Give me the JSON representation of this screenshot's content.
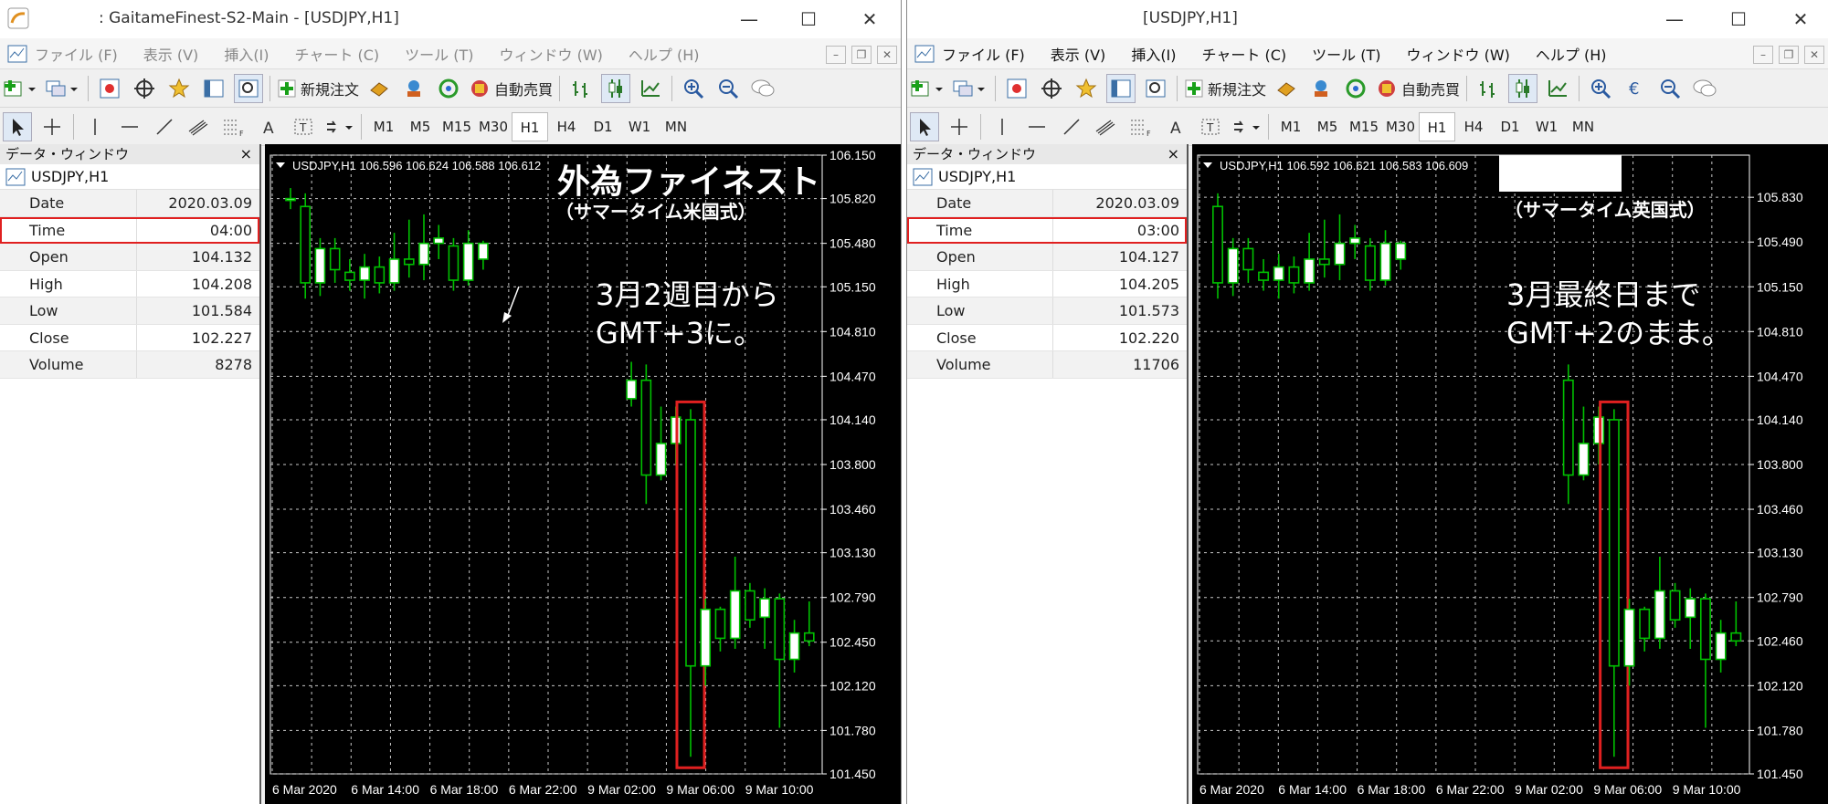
{
  "windows": [
    {
      "id": "A",
      "title": ": GaitameFinest-S2-Main - [USDJPY,H1]",
      "menu": [
        "ファイル (F)",
        "表示 (V)",
        "挿入(I)",
        "チャート (C)",
        "ツール (T)",
        "ウィンドウ (W)",
        "ヘルプ (H)"
      ],
      "toolbar": {
        "new_order": "新規注文",
        "auto_trade": "自動売買"
      },
      "timeframes": [
        "M1",
        "M5",
        "M15",
        "M30",
        "H1",
        "H4",
        "D1",
        "W1",
        "MN"
      ],
      "active_tf": "H1",
      "data_window": {
        "title": "データ・ウィンドウ",
        "symbol": "USDJPY,H1",
        "rows": [
          {
            "k": "Date",
            "v": "2020.03.09"
          },
          {
            "k": "Time",
            "v": "04:00"
          },
          {
            "k": "Open",
            "v": "104.132"
          },
          {
            "k": "High",
            "v": "104.208"
          },
          {
            "k": "Low",
            "v": "101.584"
          },
          {
            "k": "Close",
            "v": "102.227"
          },
          {
            "k": "Volume",
            "v": "8278"
          }
        ]
      },
      "chart_header": "USDJPY,H1  106.596 106.624 106.588 106.612",
      "annotations": {
        "heading": "外為ファイネスト",
        "subheading": "（サマータイム米国式）",
        "note1": "3月2週目から",
        "note2": "GMT+3に。"
      }
    },
    {
      "id": "B",
      "title": "[USDJPY,H1]",
      "menu": [
        "ファイル (F)",
        "表示 (V)",
        "挿入(I)",
        "チャート (C)",
        "ツール (T)",
        "ウィンドウ (W)",
        "ヘルプ (H)"
      ],
      "toolbar": {
        "new_order": "新規注文",
        "auto_trade": "自動売買"
      },
      "timeframes": [
        "M1",
        "M5",
        "M15",
        "M30",
        "H1",
        "H4",
        "D1",
        "W1",
        "MN"
      ],
      "active_tf": "H1",
      "data_window": {
        "title": "データ・ウィンドウ",
        "symbol": "USDJPY,H1",
        "rows": [
          {
            "k": "Date",
            "v": "2020.03.09"
          },
          {
            "k": "Time",
            "v": "03:00"
          },
          {
            "k": "Open",
            "v": "104.127"
          },
          {
            "k": "High",
            "v": "104.205"
          },
          {
            "k": "Low",
            "v": "101.573"
          },
          {
            "k": "Close",
            "v": "102.220"
          },
          {
            "k": "Volume",
            "v": "11706"
          }
        ]
      },
      "chart_header": "USDJPY,H1  106.592 106.621 106.583 106.609",
      "annotations": {
        "heading": "",
        "subheading": "（サマータイム英国式）",
        "note1": "3月最終日まで",
        "note2": "GMT+2のまま。"
      }
    }
  ],
  "chart_data": [
    {
      "type": "candlestick",
      "title": "USDJPY,H1",
      "yticks": [
        106.15,
        105.82,
        105.48,
        105.15,
        104.81,
        104.47,
        104.14,
        103.8,
        103.46,
        103.13,
        102.79,
        102.45,
        102.12,
        101.78,
        101.45
      ],
      "ylim": [
        101.45,
        106.15
      ],
      "xticks": [
        "6 Mar 2020",
        "6 Mar 14:00",
        "6 Mar 18:00",
        "6 Mar 22:00",
        "9 Mar 02:00",
        "9 Mar 06:00",
        "9 Mar 10:00"
      ],
      "grid": true,
      "candles": [
        {
          "o": 105.82,
          "c": 105.82,
          "h": 105.9,
          "l": 105.74
        },
        {
          "o": 105.76,
          "c": 105.18,
          "h": 105.86,
          "l": 105.06
        },
        {
          "o": 105.18,
          "c": 105.44,
          "h": 105.52,
          "l": 105.08
        },
        {
          "o": 105.44,
          "c": 105.28,
          "h": 105.52,
          "l": 105.18
        },
        {
          "o": 105.26,
          "c": 105.2,
          "h": 105.36,
          "l": 105.12
        },
        {
          "o": 105.2,
          "c": 105.3,
          "h": 105.4,
          "l": 105.06
        },
        {
          "o": 105.3,
          "c": 105.18,
          "h": 105.38,
          "l": 105.1
        },
        {
          "o": 105.18,
          "c": 105.36,
          "h": 105.56,
          "l": 105.12
        },
        {
          "o": 105.36,
          "c": 105.32,
          "h": 105.66,
          "l": 105.22
        },
        {
          "o": 105.32,
          "c": 105.48,
          "h": 105.7,
          "l": 105.2
        },
        {
          "o": 105.48,
          "c": 105.52,
          "h": 105.62,
          "l": 105.36
        },
        {
          "o": 105.46,
          "c": 105.2,
          "h": 105.52,
          "l": 105.12
        },
        {
          "o": 105.2,
          "c": 105.48,
          "h": 105.58,
          "l": 105.16
        },
        {
          "o": 105.36,
          "c": 105.48,
          "h": 105.5,
          "l": 105.28
        },
        {
          "gap": true
        },
        {
          "gap": true
        },
        {
          "gap": true
        },
        {
          "gap": true
        },
        {
          "gap": true
        },
        {
          "gap": true
        },
        {
          "gap": true
        },
        {
          "gap": true
        },
        {
          "gap": true
        },
        {
          "o": 104.3,
          "c": 104.44,
          "h": 104.58,
          "l": 104.24
        },
        {
          "o": 104.44,
          "c": 103.72,
          "h": 104.56,
          "l": 103.5
        },
        {
          "o": 103.72,
          "c": 103.96,
          "h": 104.24,
          "l": 103.68
        },
        {
          "o": 103.96,
          "c": 104.16,
          "h": 104.24,
          "l": 103.8
        },
        {
          "o": 104.14,
          "c": 102.27,
          "h": 104.22,
          "l": 101.58
        },
        {
          "o": 102.27,
          "c": 102.7,
          "h": 102.78,
          "l": 102.12
        },
        {
          "o": 102.7,
          "c": 102.48,
          "h": 102.72,
          "l": 102.38
        },
        {
          "o": 102.48,
          "c": 102.84,
          "h": 103.1,
          "l": 102.4
        },
        {
          "o": 102.84,
          "c": 102.62,
          "h": 102.9,
          "l": 102.56
        },
        {
          "o": 102.64,
          "c": 102.78,
          "h": 102.86,
          "l": 102.4
        },
        {
          "o": 102.78,
          "c": 102.32,
          "h": 102.82,
          "l": 101.8
        },
        {
          "o": 102.32,
          "c": 102.52,
          "h": 102.62,
          "l": 102.22
        },
        {
          "o": 102.52,
          "c": 102.46,
          "h": 102.76,
          "l": 102.42
        }
      ]
    },
    {
      "type": "candlestick",
      "title": "USDJPY,H1",
      "yticks": [
        105.83,
        105.49,
        105.15,
        104.81,
        104.47,
        104.14,
        103.8,
        103.46,
        103.13,
        102.79,
        102.46,
        102.12,
        101.78,
        101.45
      ],
      "ylim": [
        101.45,
        106.15
      ],
      "xticks": [
        "6 Mar 2020",
        "6 Mar 14:00",
        "6 Mar 18:00",
        "6 Mar 22:00",
        "9 Mar 02:00",
        "9 Mar 06:00",
        "9 Mar 10:00"
      ],
      "grid": true,
      "candles": [
        {
          "o": 105.76,
          "c": 105.18,
          "h": 105.86,
          "l": 105.06
        },
        {
          "o": 105.18,
          "c": 105.44,
          "h": 105.52,
          "l": 105.08
        },
        {
          "o": 105.44,
          "c": 105.28,
          "h": 105.52,
          "l": 105.18
        },
        {
          "o": 105.26,
          "c": 105.2,
          "h": 105.36,
          "l": 105.12
        },
        {
          "o": 105.2,
          "c": 105.3,
          "h": 105.4,
          "l": 105.06
        },
        {
          "o": 105.3,
          "c": 105.18,
          "h": 105.38,
          "l": 105.1
        },
        {
          "o": 105.18,
          "c": 105.36,
          "h": 105.56,
          "l": 105.12
        },
        {
          "o": 105.36,
          "c": 105.32,
          "h": 105.66,
          "l": 105.22
        },
        {
          "o": 105.32,
          "c": 105.48,
          "h": 105.7,
          "l": 105.2
        },
        {
          "o": 105.48,
          "c": 105.52,
          "h": 105.62,
          "l": 105.36
        },
        {
          "o": 105.46,
          "c": 105.2,
          "h": 105.52,
          "l": 105.12
        },
        {
          "o": 105.2,
          "c": 105.48,
          "h": 105.58,
          "l": 105.16
        },
        {
          "o": 105.36,
          "c": 105.48,
          "h": 105.5,
          "l": 105.28
        },
        {
          "gap": true
        },
        {
          "gap": true
        },
        {
          "gap": true
        },
        {
          "gap": true
        },
        {
          "gap": true
        },
        {
          "gap": true
        },
        {
          "gap": true
        },
        {
          "gap": true
        },
        {
          "gap": true
        },
        {
          "gap": true
        },
        {
          "o": 104.44,
          "c": 103.72,
          "h": 104.56,
          "l": 103.5
        },
        {
          "o": 103.72,
          "c": 103.96,
          "h": 104.24,
          "l": 103.68
        },
        {
          "o": 103.96,
          "c": 104.16,
          "h": 104.24,
          "l": 103.8
        },
        {
          "o": 104.14,
          "c": 102.27,
          "h": 104.22,
          "l": 101.58
        },
        {
          "o": 102.27,
          "c": 102.7,
          "h": 102.78,
          "l": 102.12
        },
        {
          "o": 102.7,
          "c": 102.48,
          "h": 102.72,
          "l": 102.38
        },
        {
          "o": 102.48,
          "c": 102.84,
          "h": 103.1,
          "l": 102.4
        },
        {
          "o": 102.84,
          "c": 102.62,
          "h": 102.9,
          "l": 102.56
        },
        {
          "o": 102.64,
          "c": 102.78,
          "h": 102.86,
          "l": 102.4
        },
        {
          "o": 102.78,
          "c": 102.32,
          "h": 102.82,
          "l": 101.8
        },
        {
          "o": 102.32,
          "c": 102.52,
          "h": 102.62,
          "l": 102.22
        },
        {
          "o": 102.52,
          "c": 102.46,
          "h": 102.76,
          "l": 102.42
        }
      ]
    }
  ],
  "colors": {
    "bull_body": "#ffffff",
    "bear_body": "#000000",
    "wick": "#00c000",
    "grid": "#c8c8c8",
    "highlight": "#e02020"
  }
}
